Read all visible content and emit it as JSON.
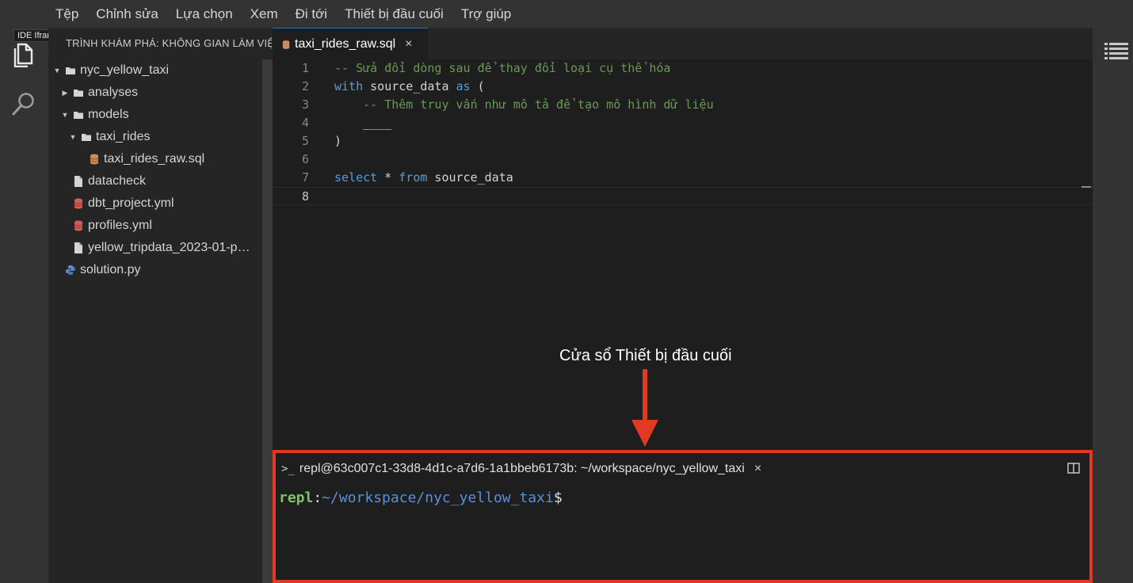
{
  "menubar": {
    "items": [
      "Tệp",
      "Chỉnh sửa",
      "Lựa chọn",
      "Xem",
      "Đi tới",
      "Thiết bị đầu cuối",
      "Trợ giúp"
    ]
  },
  "activitybar": {
    "tooltip": "IDE Iframe",
    "icons": [
      "files-icon",
      "search-icon"
    ]
  },
  "sidebar": {
    "title": "TRÌNH KHÁM PHÁ: KHÔNG GIAN LÀM VIỆC",
    "tree": [
      {
        "label": "nyc_yellow_taxi",
        "type": "folder",
        "expanded": true
      },
      {
        "label": "analyses",
        "type": "folder",
        "expanded": false
      },
      {
        "label": "models",
        "type": "folder",
        "expanded": true
      },
      {
        "label": "taxi_rides",
        "type": "folder",
        "expanded": true
      },
      {
        "label": "taxi_rides_raw.sql",
        "type": "database-file"
      },
      {
        "label": "datacheck",
        "type": "file"
      },
      {
        "label": "dbt_project.yml",
        "type": "database-file"
      },
      {
        "label": "profiles.yml",
        "type": "database-file"
      },
      {
        "label": "yellow_tripdata_2023-01-p…",
        "type": "file"
      },
      {
        "label": "solution.py",
        "type": "python-file"
      }
    ]
  },
  "editor": {
    "tab": {
      "label": "taxi_rides_raw.sql",
      "close": "×"
    },
    "line_numbers": [
      "1",
      "2",
      "3",
      "4",
      "5",
      "6",
      "7",
      "8"
    ],
    "code": {
      "l1": "-- Sửa đổi dòng sau để thay đổi loại cụ thể hóa",
      "l2_kw1": "with",
      "l2_mid": " source_data ",
      "l2_kw2": "as",
      "l2_end": " (",
      "l3": "    -- Thêm truy vấn như mô tả để tạo mô hình dữ liệu",
      "l4": "    ____",
      "l5": ")",
      "l7_kw1": "select",
      "l7_mid": " * ",
      "l7_kw2": "from",
      "l7_end": " source_data"
    }
  },
  "annotation": {
    "text": "Cửa sổ Thiết bị đầu cuối"
  },
  "terminal": {
    "tab_title": "repl@63c007c1-33d8-4d1c-a7d6-1a1bbeb6173b: ~/workspace/nyc_yellow_taxi",
    "tab_icon": ">_",
    "close": "×",
    "prompt_user": "repl",
    "prompt_sep": ":",
    "prompt_path": "~/workspace/nyc_yellow_taxi",
    "prompt_symbol": "$"
  },
  "colors": {
    "highlight_border": "#e03a25",
    "comment": "#6a9955",
    "keyword": "#569cd6",
    "terminal_user": "#7ec36b",
    "terminal_path": "#5b8fd9"
  }
}
